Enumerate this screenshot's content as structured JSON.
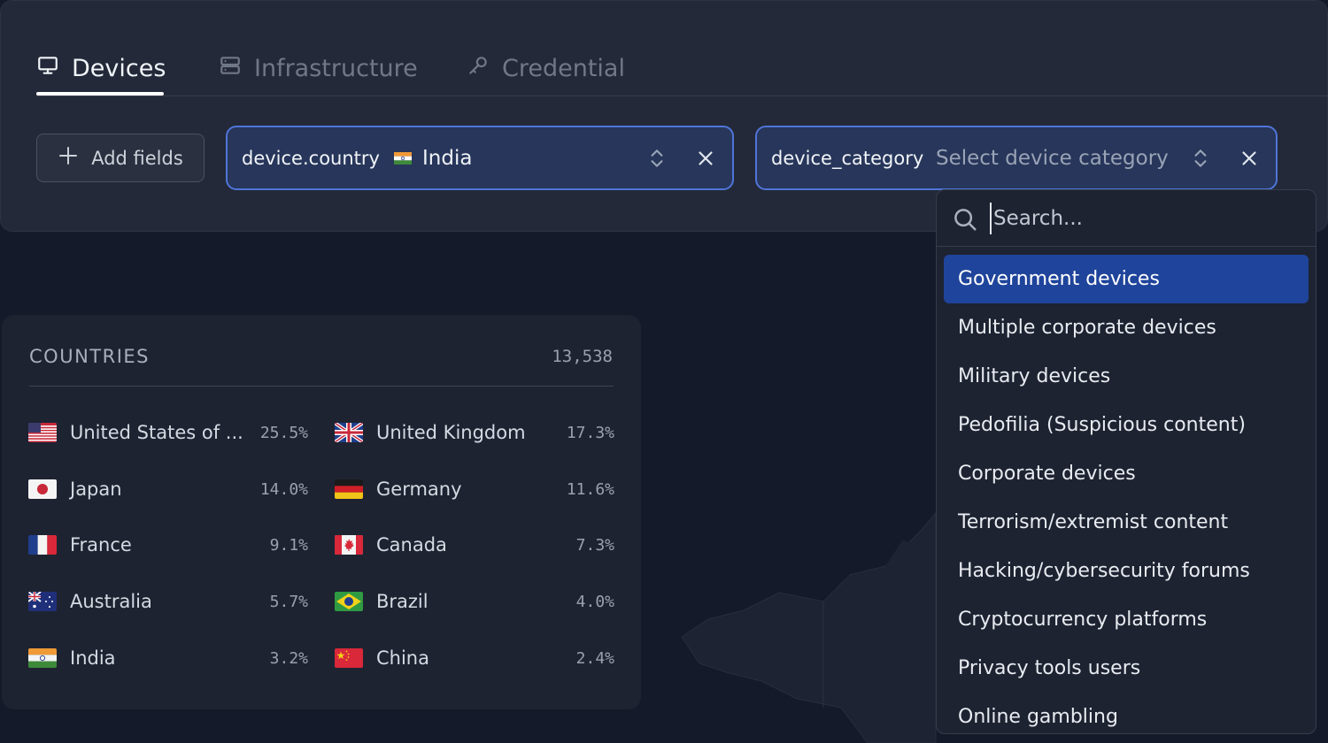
{
  "tabs": [
    {
      "label": "Devices",
      "icon": "monitor-icon",
      "active": true
    },
    {
      "label": "Infrastructure",
      "icon": "server-icon",
      "active": false
    },
    {
      "label": "Credential",
      "icon": "key-icon",
      "active": false
    }
  ],
  "toolbar": {
    "add_fields_label": "Add fields"
  },
  "filters": [
    {
      "key": "device.country",
      "value": "India",
      "flag": "india-flag-icon"
    },
    {
      "key": "device_category",
      "placeholder": "Select device category"
    }
  ],
  "countries": {
    "title": "COUNTRIES",
    "total": "13,538",
    "items": [
      {
        "name": "United States of ...",
        "pct": "25.5%",
        "flag": "us-flag-icon"
      },
      {
        "name": "United Kingdom",
        "pct": "17.3%",
        "flag": "uk-flag-icon"
      },
      {
        "name": "Japan",
        "pct": "14.0%",
        "flag": "japan-flag-icon"
      },
      {
        "name": "Germany",
        "pct": "11.6%",
        "flag": "germany-flag-icon"
      },
      {
        "name": "France",
        "pct": "9.1%",
        "flag": "france-flag-icon"
      },
      {
        "name": "Canada",
        "pct": "7.3%",
        "flag": "canada-flag-icon"
      },
      {
        "name": "Australia",
        "pct": "5.7%",
        "flag": "australia-flag-icon"
      },
      {
        "name": "Brazil",
        "pct": "4.0%",
        "flag": "brazil-flag-icon"
      },
      {
        "name": "India",
        "pct": "3.2%",
        "flag": "india-flag-icon"
      },
      {
        "name": "China",
        "pct": "2.4%",
        "flag": "china-flag-icon"
      }
    ]
  },
  "dropdown": {
    "search_placeholder": "Search...",
    "options": [
      "Government devices",
      "Multiple corporate devices",
      "Military devices",
      "Pedofilia (Suspicious content)",
      "Corporate devices",
      "Terrorism/extremist content",
      "Hacking/cybersecurity forums",
      "Cryptocurrency platforms",
      "Privacy tools users",
      "Online gambling"
    ],
    "selected_index": 0
  },
  "colors": {
    "accent": "#4f75d8",
    "selected": "#1f449b",
    "background": "#141a29"
  }
}
